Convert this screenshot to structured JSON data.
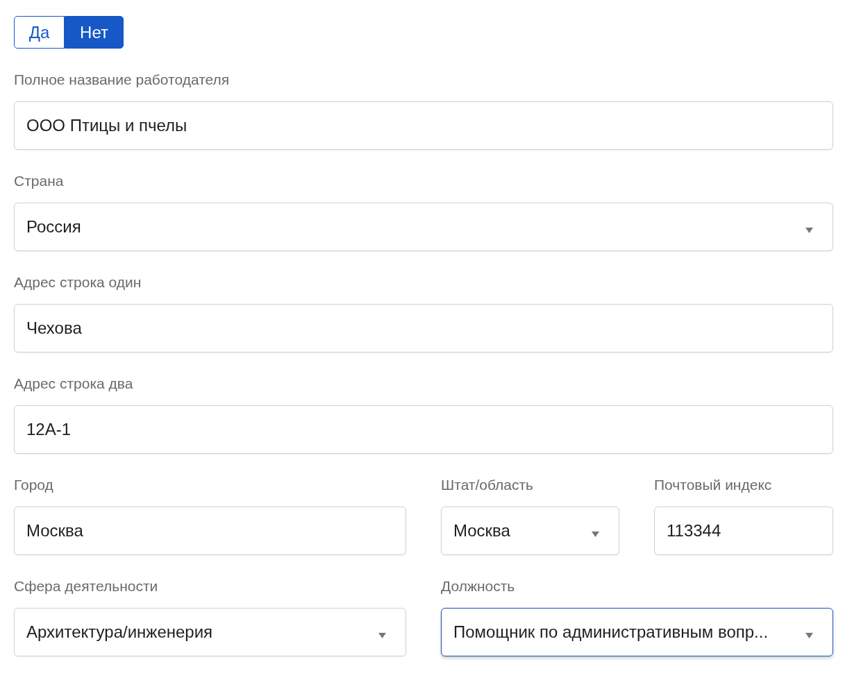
{
  "toggle": [
    {
      "label": "Да",
      "selected": false
    },
    {
      "label": "Нет",
      "selected": true
    }
  ],
  "rows": [
    [
      {
        "label": "Полное название работодателя",
        "value": "ООО Птицы и пчелы",
        "kind": "text",
        "focused": false
      }
    ],
    [
      {
        "label": "Страна",
        "value": "Россия",
        "kind": "select",
        "focused": false
      }
    ],
    [
      {
        "label": "Адрес строка один",
        "value": "Чехова",
        "kind": "text",
        "focused": false
      }
    ],
    [
      {
        "label": "Адрес строка два",
        "value": "12A-1",
        "kind": "text",
        "focused": false
      }
    ],
    [
      {
        "label": "Город",
        "value": "Москва",
        "kind": "text",
        "focused": false
      },
      {
        "label": "Штат/область",
        "value": "Москва",
        "kind": "select",
        "focused": false
      },
      {
        "label": "Почтовый индекс",
        "value": "113344",
        "kind": "text",
        "focused": false
      }
    ],
    [
      {
        "label": "Сфера деятельности",
        "value": "Архитектура/инженерия",
        "kind": "select",
        "focused": false
      },
      {
        "label": "Должность",
        "value": "Помощник по административным вопр...",
        "kind": "select",
        "focused": true
      }
    ]
  ]
}
